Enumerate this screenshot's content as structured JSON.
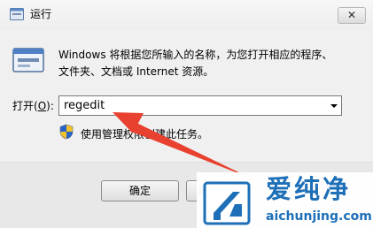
{
  "window": {
    "title": "运行",
    "close_glyph": "✕"
  },
  "dialog": {
    "description_line1": "Windows 将根据您所输入的名称，为您打开相应的程序、",
    "description_line2": "文件夹、文档或 Internet 资源。",
    "open_label_prefix": "打开(",
    "open_label_key": "O",
    "open_label_suffix": "):",
    "command_value": "regedit",
    "admin_note": "使用管理权限创建此任务。"
  },
  "buttons": {
    "ok": "确定",
    "cancel": "取"
  },
  "watermark": {
    "brand": "爱纯净",
    "url": "aichunjing.com"
  },
  "icons": {
    "app": "run-dialog-icon",
    "run": "run-window-icon",
    "shield": "uac-shield-icon",
    "dropdown": "chevron-down-icon",
    "watermark": "aichunjing-logo-icon"
  },
  "colors": {
    "arrow": "#e8412f",
    "watermark": "#1d6fb8",
    "shield_blue": "#2a63c4",
    "shield_yellow": "#f2c12e"
  }
}
